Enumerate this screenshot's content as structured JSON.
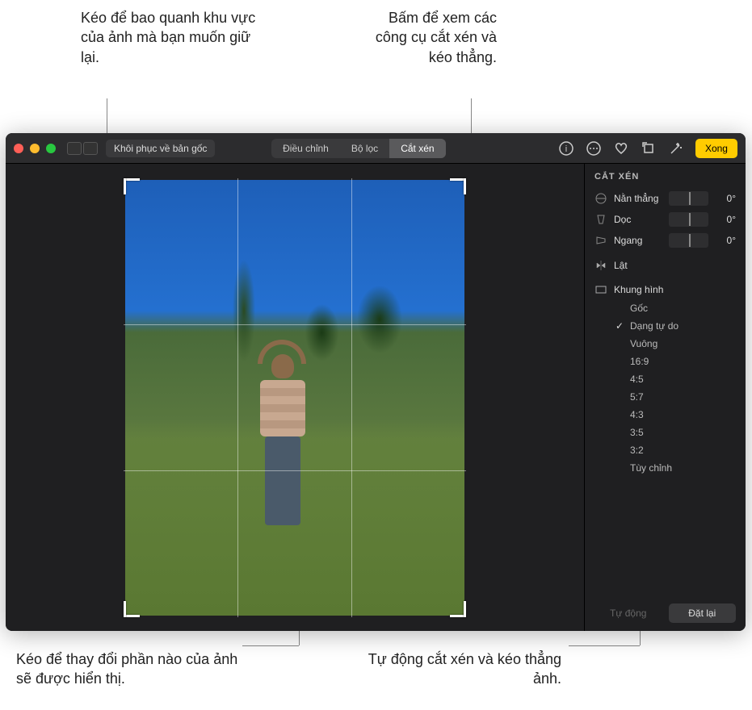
{
  "callouts": {
    "top_left": "Kéo để bao quanh khu vực của ảnh mà bạn muốn giữ lại.",
    "top_right": "Bấm để xem các công cụ cắt xén và kéo thẳng.",
    "bottom_left": "Kéo để thay đổi phần nào của ảnh sẽ được hiển thị.",
    "bottom_right": "Tự động cắt xén và kéo thẳng ảnh."
  },
  "toolbar": {
    "revert": "Khôi phục về bản gốc",
    "segments": {
      "adjust": "Điều chỉnh",
      "filters": "Bộ lọc",
      "crop": "Cắt xén"
    },
    "done": "Xong"
  },
  "sidebar": {
    "title": "CẮT XÉN",
    "sliders": {
      "straighten": {
        "label": "Nằn thẳng",
        "value": "0°"
      },
      "vertical": {
        "label": "Dọc",
        "value": "0°"
      },
      "horizontal": {
        "label": "Ngang",
        "value": "0°"
      }
    },
    "flip": "Lật",
    "aspect": {
      "header": "Khung hình",
      "items": {
        "original": "Gốc",
        "freeform": "Dạng tự do",
        "square": "Vuông",
        "r16_9": "16:9",
        "r4_5": "4:5",
        "r5_7": "5:7",
        "r4_3": "4:3",
        "r3_5": "3:5",
        "r3_2": "3:2",
        "custom": "Tùy chỉnh"
      },
      "selected": "freeform"
    },
    "footer": {
      "auto": "Tự động",
      "reset": "Đặt lại"
    }
  }
}
